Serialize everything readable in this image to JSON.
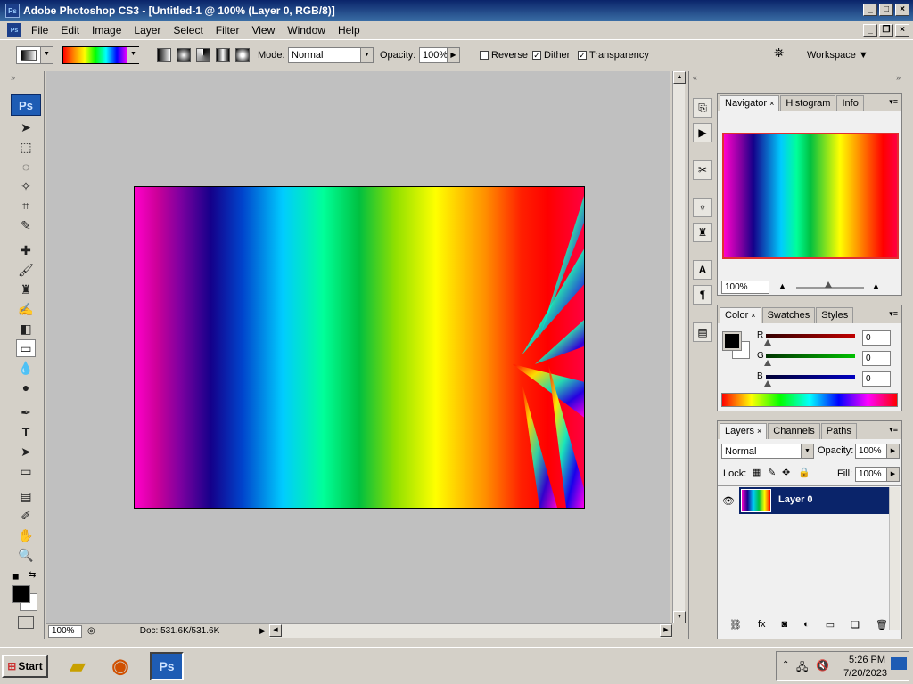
{
  "window": {
    "title": "Adobe Photoshop CS3 - [Untitled-1 @ 100% (Layer 0, RGB/8)]",
    "app_icon": "Ps"
  },
  "menu": [
    "File",
    "Edit",
    "Image",
    "Layer",
    "Select",
    "Filter",
    "View",
    "Window",
    "Help"
  ],
  "options_bar": {
    "mode_label": "Mode:",
    "mode_value": "Normal",
    "opacity_label": "Opacity:",
    "opacity_value": "100%",
    "reverse_label": "Reverse",
    "reverse_checked": false,
    "dither_label": "Dither",
    "dither_checked": true,
    "transparency_label": "Transparency",
    "transparency_checked": true,
    "workspace_label": "Workspace"
  },
  "toolbox": {
    "logo": "Ps"
  },
  "status": {
    "zoom": "100%",
    "doc_info": "Doc: 531.6K/531.6K"
  },
  "navigator_panel": {
    "tabs": [
      "Navigator",
      "Histogram",
      "Info"
    ],
    "zoom": "100%"
  },
  "color_panel": {
    "tabs": [
      "Color",
      "Swatches",
      "Styles"
    ],
    "channels": [
      {
        "label": "R",
        "value": "0",
        "color": "#c00000"
      },
      {
        "label": "G",
        "value": "0",
        "color": "#00a000"
      },
      {
        "label": "B",
        "value": "0",
        "color": "#0000c0"
      }
    ]
  },
  "layers_panel": {
    "tabs": [
      "Layers",
      "Channels",
      "Paths"
    ],
    "blend_mode": "Normal",
    "opacity_label": "Opacity:",
    "opacity_value": "100%",
    "lock_label": "Lock:",
    "fill_label": "Fill:",
    "fill_value": "100%",
    "layers": [
      {
        "name": "Layer 0",
        "visible": true,
        "selected": true
      }
    ]
  },
  "taskbar": {
    "start_label": "Start",
    "ps_button": "Ps",
    "time": "5:26 PM",
    "date": "7/20/2023"
  },
  "colors": {
    "title_bar": "#0a246a",
    "selected_layer": "#0a246a",
    "accent": "#1e5cb4"
  }
}
